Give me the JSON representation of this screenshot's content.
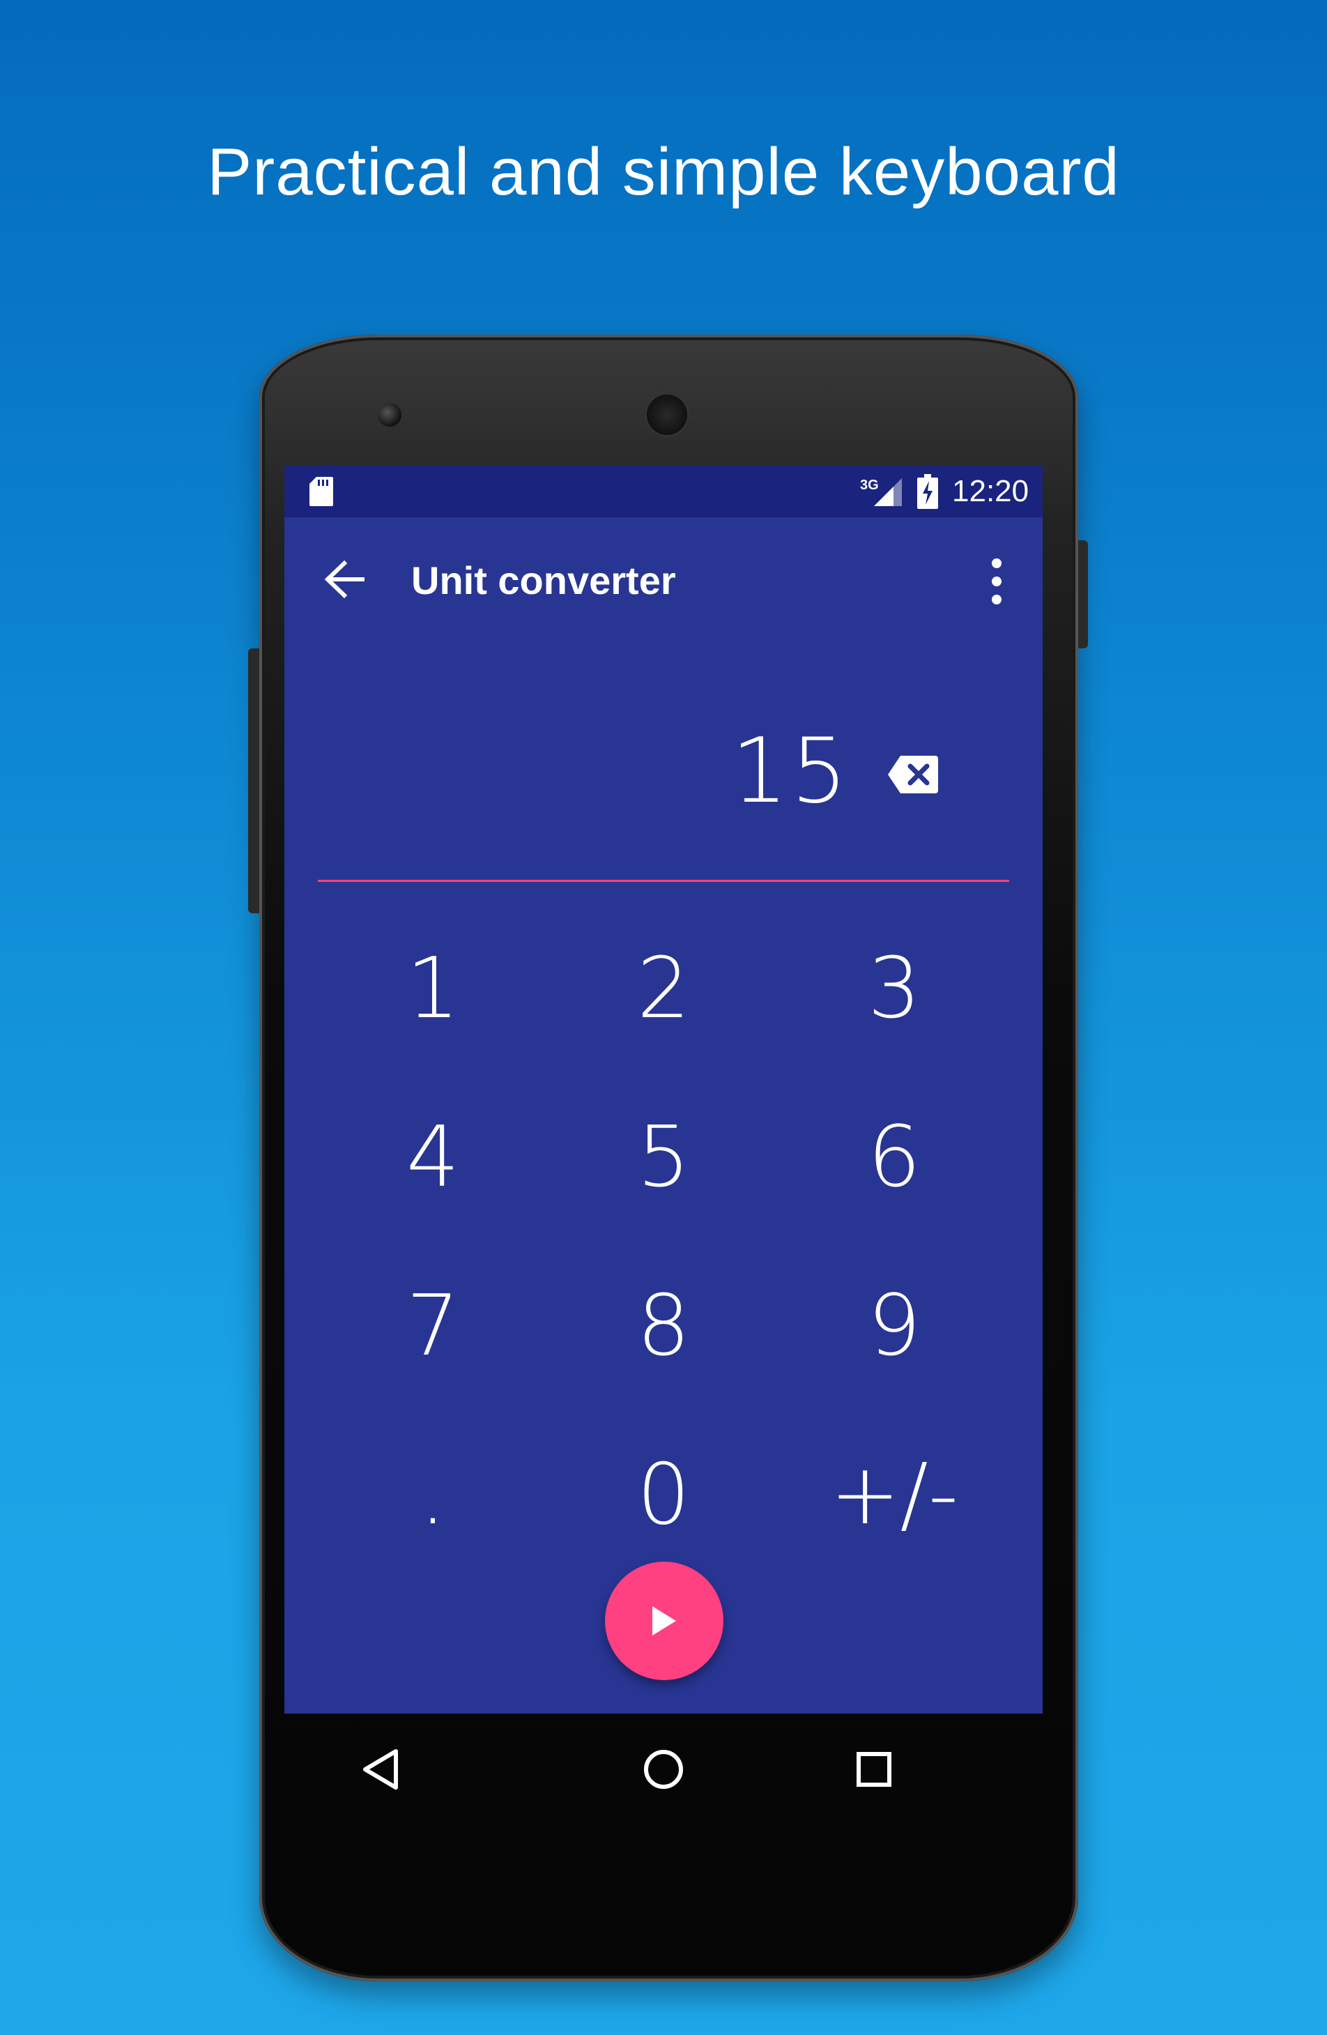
{
  "headline": "Practical and simple keyboard",
  "status_bar": {
    "network_label": "3G",
    "time": "12:20"
  },
  "toolbar": {
    "title": "Unit converter"
  },
  "display": {
    "value": "15"
  },
  "keypad": {
    "keys": [
      "1",
      "2",
      "3",
      "4",
      "5",
      "6",
      "7",
      "8",
      "9",
      ".",
      "0",
      "+/-"
    ]
  },
  "colors": {
    "primary": "#283593",
    "primary_dark": "#1a237e",
    "accent": "#ff4081",
    "background_top": "#046bbd",
    "background_bottom": "#1ea6e9"
  },
  "icons": {
    "back": "arrow-left-icon",
    "menu": "more-vert-icon",
    "backspace": "backspace-icon",
    "fab": "play-icon",
    "nav_back": "triangle-back-icon",
    "nav_home": "circle-home-icon",
    "nav_recents": "square-recents-icon"
  }
}
